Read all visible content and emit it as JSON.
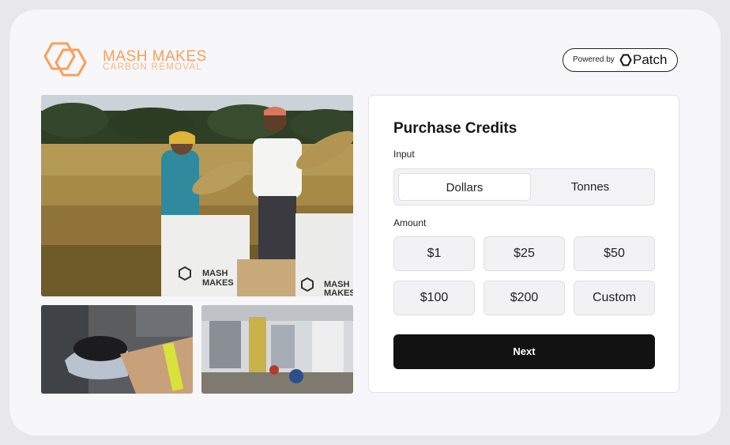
{
  "brand": {
    "title": "MASH MAKES",
    "subtitle": "CARBON REMOVAL",
    "accent": "#f5a15c"
  },
  "powered_by": {
    "label": "Powered by",
    "brand": "Patch"
  },
  "purchase": {
    "title": "Purchase Credits",
    "input_label": "Input",
    "input_options": [
      "Dollars",
      "Tonnes"
    ],
    "selected_input": "Dollars",
    "amount_label": "Amount",
    "amounts": [
      "$1",
      "$25",
      "$50",
      "$100",
      "$200",
      "Custom"
    ],
    "next_label": "Next"
  },
  "photos": {
    "bag_text_1": "MASH",
    "bag_text_2": "MAKES"
  }
}
